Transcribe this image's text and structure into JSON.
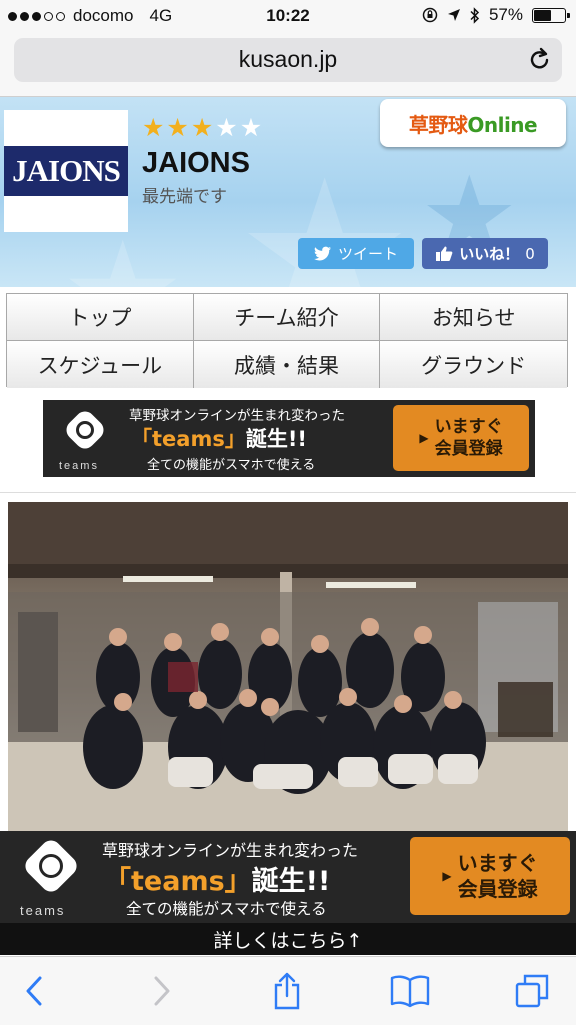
{
  "status_bar": {
    "carrier": "docomo",
    "network": "4G",
    "time": "10:22",
    "battery_percent": "57%",
    "battery_level": 0.57,
    "signal_bars": 3,
    "signal_total": 5
  },
  "browser": {
    "url": "kusaon.jp",
    "reload_icon": "reload-icon"
  },
  "header": {
    "logo_text": "JAIONS",
    "rating": 3,
    "rating_max": 5,
    "team_name": "JAIONS",
    "team_subtitle": "最先端です",
    "brand": {
      "part1": "草野球",
      "part2": "Online"
    },
    "tweet_label": "ツイート",
    "like_label": "いいね！",
    "like_count": "0"
  },
  "nav": {
    "items": [
      {
        "label": "トップ"
      },
      {
        "label": "チーム紹介"
      },
      {
        "label": "お知らせ"
      },
      {
        "label": "スケジュール"
      },
      {
        "label": "成績・結果"
      },
      {
        "label": "グラウンド"
      }
    ]
  },
  "banner": {
    "brand": "teams",
    "line1": "草野球オンラインが生まれ変わった",
    "line2_quote": "「teams」",
    "line2_rest": "誕生!!",
    "line3": "全ての機能がスマホで使える",
    "cta_line1": "いますぐ",
    "cta_line2": "会員登録"
  },
  "detail_link": "詳しくはこちら↑",
  "colors": {
    "header_bg": "#a6d2ef",
    "logo_band": "#1d2a6b",
    "star_on": "#f2b01e",
    "tweet_bg": "#4fa8e6",
    "like_bg": "#4a68b0",
    "cta_bg": "#e38a22",
    "banner_bg": "#262626",
    "ios_blue": "#2f7cf6"
  },
  "toolbar": {
    "icons": [
      "back-icon",
      "forward-icon",
      "share-icon",
      "bookmarks-icon",
      "tabs-icon"
    ]
  }
}
